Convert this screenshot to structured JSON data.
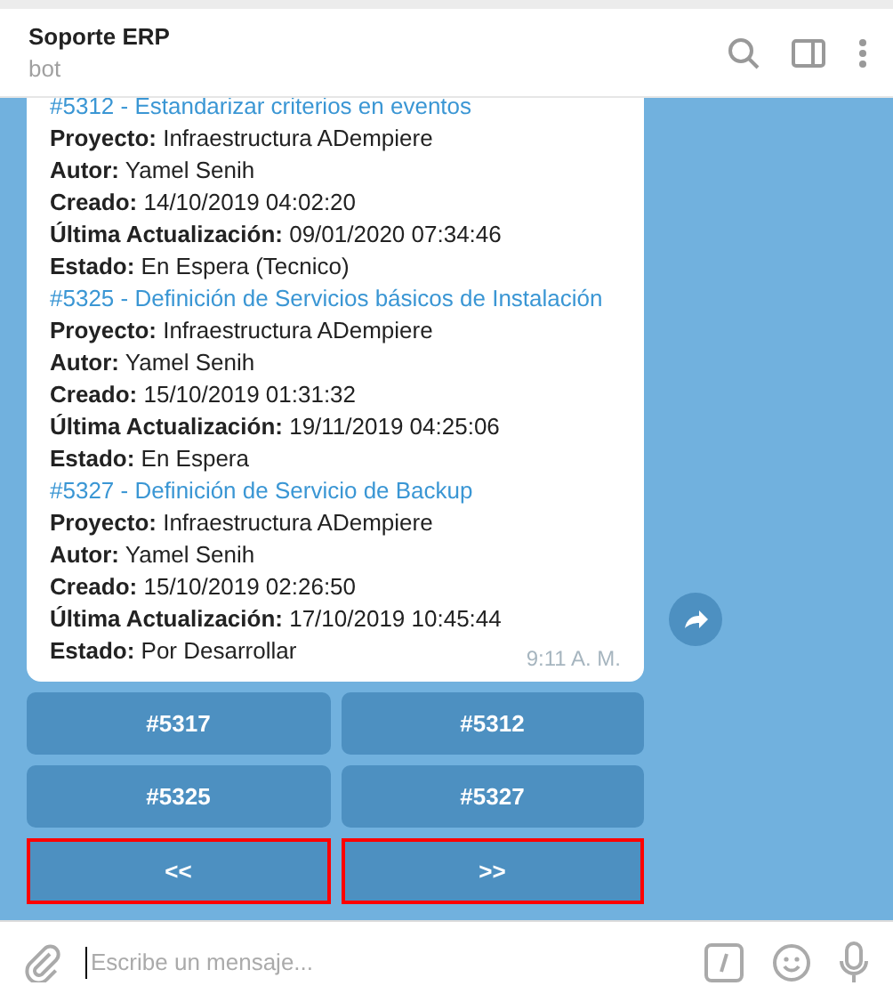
{
  "header": {
    "title": "Soporte ERP",
    "subtitle": "bot"
  },
  "message": {
    "tickets": [
      {
        "title": "#5312 - Estandarizar criterios en eventos",
        "fields": [
          "**Proyecto:** Infraestructura ADempiere",
          "**Autor:** Yamel Senih",
          "**Creado:** 14/10/2019 04:02:20",
          "**Última Actualización:** 09/01/2020 07:34:46",
          "**Estado:** En Espera (Tecnico)"
        ]
      },
      {
        "title": "#5325 - Definición de Servicios básicos de Instalación",
        "fields": [
          "**Proyecto:** Infraestructura ADempiere",
          "**Autor:** Yamel Senih",
          "**Creado:** 15/10/2019 01:31:32",
          "**Última Actualización:** 19/11/2019 04:25:06",
          "**Estado:** En Espera"
        ]
      },
      {
        "title": "#5327 - Definición de Servicio de Backup",
        "fields": [
          "**Proyecto:** Infraestructura ADempiere",
          "**Autor:** Yamel Senih",
          "**Creado:** 15/10/2019 02:26:50",
          "**Última Actualización:** 17/10/2019 10:45:44",
          "**Estado:** Por Desarrollar"
        ]
      }
    ],
    "time": "9:11 A. M."
  },
  "keyboard": [
    [
      {
        "label": "#5317",
        "highlighted": false
      },
      {
        "label": "#5312",
        "highlighted": false
      }
    ],
    [
      {
        "label": "#5325",
        "highlighted": false
      },
      {
        "label": "#5327",
        "highlighted": false
      }
    ],
    [
      {
        "label": "<<",
        "highlighted": true
      },
      {
        "label": ">>",
        "highlighted": true
      }
    ]
  ],
  "composer": {
    "placeholder": "Escribe un mensaje..."
  }
}
